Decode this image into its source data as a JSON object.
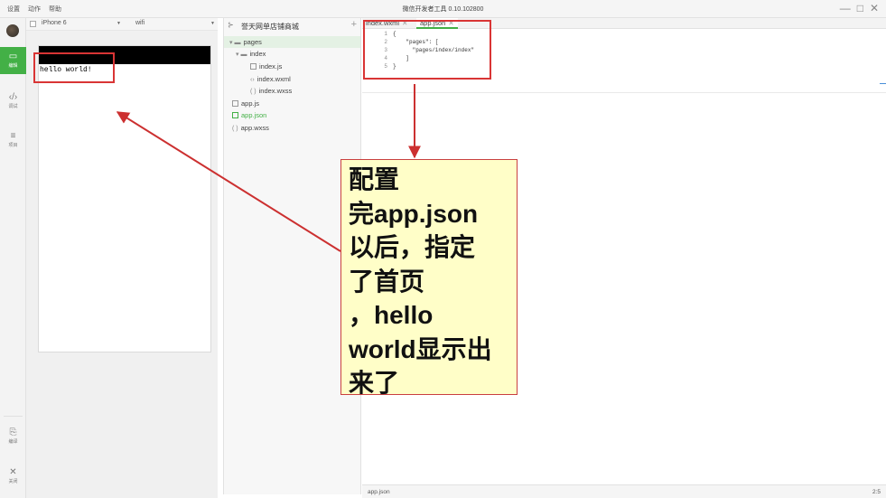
{
  "window": {
    "title": "微信开发者工具 0.10.102800",
    "menu": [
      "设置",
      "动作",
      "帮助"
    ]
  },
  "activity_bar": {
    "items": [
      {
        "id": "edit",
        "label": "编辑",
        "icon": "code-box-icon",
        "active": true
      },
      {
        "id": "debug",
        "label": "调试",
        "icon": "angle-brackets-icon",
        "active": false
      },
      {
        "id": "project",
        "label": "项目",
        "icon": "list-icon",
        "active": false
      },
      {
        "id": "compile",
        "label": "编译",
        "icon": "compile-icon",
        "active": false
      },
      {
        "id": "close",
        "label": "关闭",
        "icon": "close-icon",
        "active": false
      }
    ]
  },
  "simulator": {
    "device": "iPhone 6",
    "network": "wifi",
    "content_text": "hello world!"
  },
  "project": {
    "name": "誉天网单店铺商城",
    "tree": [
      {
        "label": "pages",
        "type": "folder",
        "depth": 0,
        "expanded": true,
        "selected": true
      },
      {
        "label": "index",
        "type": "folder",
        "depth": 1,
        "expanded": true
      },
      {
        "label": "index.js",
        "type": "js",
        "depth": 2
      },
      {
        "label": "index.wxml",
        "type": "wxml",
        "depth": 2
      },
      {
        "label": "index.wxss",
        "type": "wxss",
        "depth": 2
      },
      {
        "label": "app.js",
        "type": "js",
        "depth": 0
      },
      {
        "label": "app.json",
        "type": "json",
        "depth": 0,
        "active": true
      },
      {
        "label": "app.wxss",
        "type": "wxss",
        "depth": 0
      }
    ]
  },
  "editor": {
    "tabs": [
      {
        "label": "index.wxml",
        "active": false
      },
      {
        "label": "app.json",
        "active": true
      }
    ],
    "lines": [
      {
        "num": "1",
        "text": "{"
      },
      {
        "num": "2",
        "text": "    \"pages\": ["
      },
      {
        "num": "3",
        "text": "      \"pages/index/index\""
      },
      {
        "num": "4",
        "text": "    ]"
      },
      {
        "num": "5",
        "text": "}"
      }
    ],
    "status_file": "app.json",
    "status_pos": "2:5"
  },
  "annotation": {
    "lines": [
      "配置",
      "完app.json",
      "以后，指定",
      "了首页",
      "，hello",
      "world显示出",
      "来了"
    ],
    "colors": {
      "box_border": "#d93535",
      "callout_bg": "#fffec8",
      "arrow": "#cc3030"
    }
  }
}
